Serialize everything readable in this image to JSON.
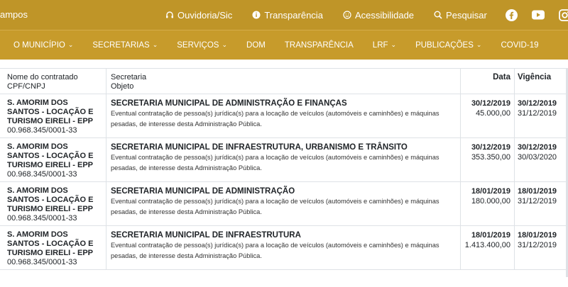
{
  "topbar": {
    "brand": "ampos",
    "links": [
      {
        "icon": "headset-icon",
        "label": "Ouvidoria/Sic"
      },
      {
        "icon": "info-icon",
        "label": "Transparência"
      },
      {
        "icon": "smile-icon",
        "label": "Acessibilidade"
      },
      {
        "icon": "search-icon",
        "label": "Pesquisar"
      }
    ],
    "social": [
      "facebook-icon",
      "youtube-icon",
      "instagram-icon"
    ]
  },
  "nav": [
    {
      "label": "O MUNICÍPIO",
      "dropdown": true
    },
    {
      "label": "SECRETARIAS",
      "dropdown": true
    },
    {
      "label": "SERVIÇOS",
      "dropdown": true
    },
    {
      "label": "DOM",
      "dropdown": false
    },
    {
      "label": "TRANSPARÊNCIA",
      "dropdown": false
    },
    {
      "label": "LRF",
      "dropdown": true
    },
    {
      "label": "PUBLICAÇÕES",
      "dropdown": true
    },
    {
      "label": "COVID-19",
      "dropdown": false
    }
  ],
  "table": {
    "headers": {
      "col1_line1": "Nome do contratado",
      "col1_line2": "CPF/CNPJ",
      "col2_line1": "Secretaria",
      "col2_line2": "Objeto",
      "col3": "Data",
      "col4": "Vigência"
    },
    "rows": [
      {
        "name": "S. AMORIM DOS SANTOS - LOCAÇÃO E TURISMO EIRELI - EPP",
        "cnpj": "00.968.345/0001-33",
        "secretaria": "SECRETARIA MUNICIPAL DE ADMINISTRAÇÃO E FINANÇAS",
        "objeto": "Eventual contratação de pessoa(s) jurídica(s) para a locação de veículos (automóveis e caminhões) e máquinas pesadas, de interesse desta Administração Pública.",
        "data": "30/12/2019",
        "valor": "45.000,00",
        "vig_inicio": "30/12/2019",
        "vig_fim": "31/12/2019"
      },
      {
        "name": "S. AMORIM DOS SANTOS - LOCAÇÃO E TURISMO EIRELI - EPP",
        "cnpj": "00.968.345/0001-33",
        "secretaria": "SECRETARIA MUNICIPAL DE INFRAESTRUTURA, URBANISMO E TRÂNSITO",
        "objeto": "Eventual contratação de pessoa(s) jurídica(s) para a locação de veículos (automóveis e caminhões) e máquinas pesadas, de interesse desta Administração Pública.",
        "data": "30/12/2019",
        "valor": "353.350,00",
        "vig_inicio": "30/12/2019",
        "vig_fim": "30/03/2020"
      },
      {
        "name": "S. AMORIM DOS SANTOS - LOCAÇÃO E TURISMO EIRELI - EPP",
        "cnpj": "00.968.345/0001-33",
        "secretaria": "SECRETARIA MUNICIPAL DE ADMINISTRAÇÃO",
        "objeto": "Eventual contratação de pessoa(s) jurídica(s) para a locação de veículos (automóveis e caminhões) e máquinas pesadas, de interesse desta Administração Pública.",
        "data": "18/01/2019",
        "valor": "180.000,00",
        "vig_inicio": "18/01/2019",
        "vig_fim": "31/12/2019"
      },
      {
        "name": "S. AMORIM DOS SANTOS - LOCAÇÃO E TURISMO EIRELI - EPP",
        "cnpj": "00.968.345/0001-33",
        "secretaria": "SECRETARIA MUNICIPAL DE INFRAESTRUTURA",
        "objeto": "Eventual contratação de pessoa(s) jurídica(s) para a locação de veículos (automóveis e caminhões) e máquinas pesadas, de interesse desta Administração Pública.",
        "data": "18/01/2019",
        "valor": "1.413.400,00",
        "vig_inicio": "18/01/2019",
        "vig_fim": "31/12/2019"
      }
    ]
  }
}
